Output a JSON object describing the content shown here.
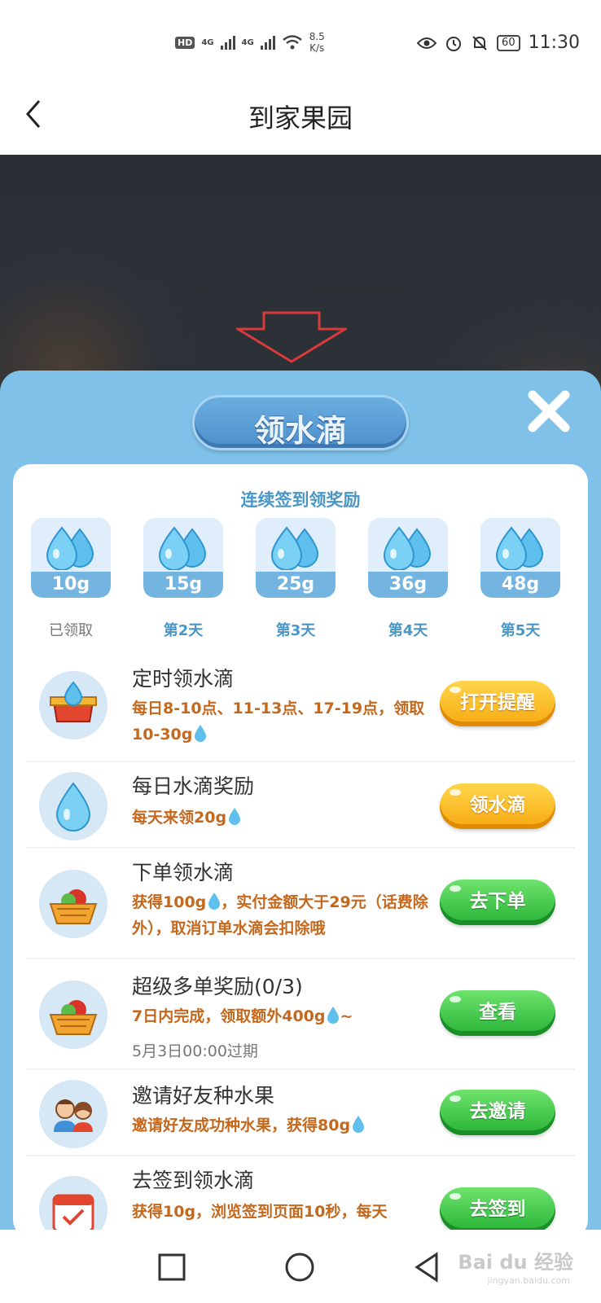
{
  "status_bar": {
    "hd": "HD",
    "net1": "4G",
    "net2": "4G",
    "speed_value": "8.5",
    "speed_unit": "K/s",
    "battery": "60",
    "time": "11:30"
  },
  "header": {
    "title": "到家果园"
  },
  "panel": {
    "title": "领水滴",
    "heading": "连续签到领奖励",
    "days": [
      {
        "amount": "10g",
        "label": "已领取"
      },
      {
        "amount": "15g",
        "label": "第2天"
      },
      {
        "amount": "25g",
        "label": "第3天"
      },
      {
        "amount": "36g",
        "label": "第4天"
      },
      {
        "amount": "48g",
        "label": "第5天"
      }
    ],
    "tasks": [
      {
        "title": "定时领水滴",
        "desc": "每日8-10点、11-13点、17-19点，领取10-30g",
        "sub": "",
        "button": "打开提醒"
      },
      {
        "title": "每日水滴奖励",
        "desc": "每天来领20g",
        "sub": "",
        "button": "领水滴"
      },
      {
        "title": "下单领水滴",
        "desc_a": "获得100g",
        "desc_b": "，实付金额大于29元（话费除外），取消订单水滴会扣除哦",
        "button": "去下单"
      },
      {
        "title": "超级多单奖励(0/3)",
        "desc_a": "7日内完成，领取额外400g",
        "desc_b": "~",
        "sub": "5月3日00:00过期",
        "button": "查看"
      },
      {
        "title": "邀请好友种水果",
        "desc": "邀请好友成功种水果，获得80g",
        "button": "去邀请"
      },
      {
        "title": "去签到领水滴",
        "desc": "获得10g，浏览签到页面10秒，每天",
        "button": "去签到"
      }
    ]
  },
  "watermark": {
    "main": "Bai du 经验",
    "sub": "jingyan.baidu.com"
  },
  "colors": {
    "panel_bg": "#7fc1e8",
    "accent_blue": "#4a96c4",
    "orange_button": "#f7a911",
    "green_button": "#27b336",
    "desc_text": "#c4681d"
  }
}
